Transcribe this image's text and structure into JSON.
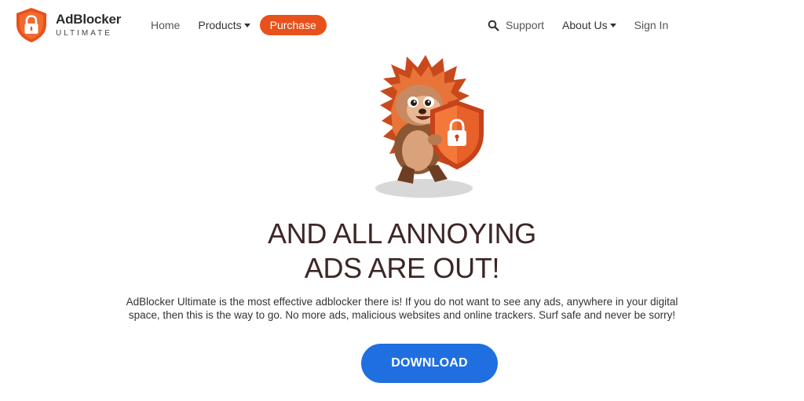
{
  "brand": {
    "name": "AdBlocker",
    "subtitle": "ULTIMATE",
    "accent": "#e8511c"
  },
  "nav": {
    "home": "Home",
    "products": "Products",
    "purchase": "Purchase",
    "support": "Support",
    "about": "About Us",
    "signin": "Sign In"
  },
  "hero": {
    "headline_line1": "AND ALL ANNOYING",
    "headline_line2": "ADS ARE OUT!",
    "description": "AdBlocker Ultimate is the most effective adblocker there is! If you do not want to see any ads, anywhere in your digital space, then this is the way to go. No more ads, malicious websites and online trackers. Surf safe and never be sorry!",
    "download": "DOWNLOAD",
    "download_color": "#1f6fe0"
  },
  "icons": {
    "logo": "shield-lock-icon",
    "search": "search-icon",
    "dropdown": "caret-down-icon",
    "mascot": "hedgehog-mascot-icon"
  }
}
